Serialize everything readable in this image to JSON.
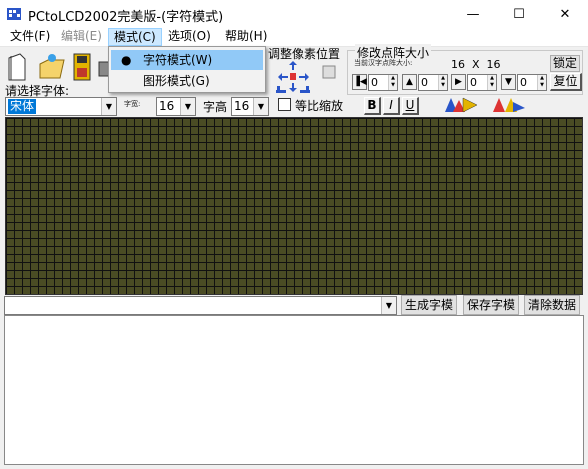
{
  "window": {
    "title": "PCtoLCD2002完美版-(字符模式)",
    "controls": {
      "minimize": "—",
      "maximize": "☐",
      "close": "✕"
    }
  },
  "menubar": {
    "items": [
      {
        "label": "文件(F)"
      },
      {
        "label": "编辑(E)"
      },
      {
        "label": "模式(C)"
      },
      {
        "label": "选项(O)"
      },
      {
        "label": "帮助(H)"
      }
    ]
  },
  "mode_menu": {
    "items": [
      {
        "label": "字符模式(W)",
        "checked": true
      },
      {
        "label": "图形模式(G)",
        "checked": false
      }
    ]
  },
  "toolbar": {
    "font_select_label": "请选择字体:",
    "font_value": "宋体",
    "char_width_label": "字宽:",
    "char_width_value": "16",
    "char_height_label": "字高",
    "char_height_value": "16",
    "proportional_label": "等比缩放",
    "bold_label": "B",
    "italic_label": "I",
    "underline_label": "U"
  },
  "adjust_position": {
    "title": "调整像素位置"
  },
  "resize_matrix": {
    "title": "修改点阵大小",
    "current_label": "当前汉字点阵大小:",
    "current_size": "16  X  16",
    "lock_label": "锁定",
    "restore_label": "复位",
    "spinners": [
      "0",
      "0",
      "0",
      "0"
    ]
  },
  "bottom_bar": {
    "input_value": "",
    "generate_label": "生成字模",
    "save_label": "保存字模",
    "clear_label": "清除数据"
  },
  "colors": {
    "grid_bg": "#4a4c24",
    "grid_line": "#111111",
    "menu_highlight": "#91c9f7",
    "font_select_bg": "#0078d7"
  }
}
